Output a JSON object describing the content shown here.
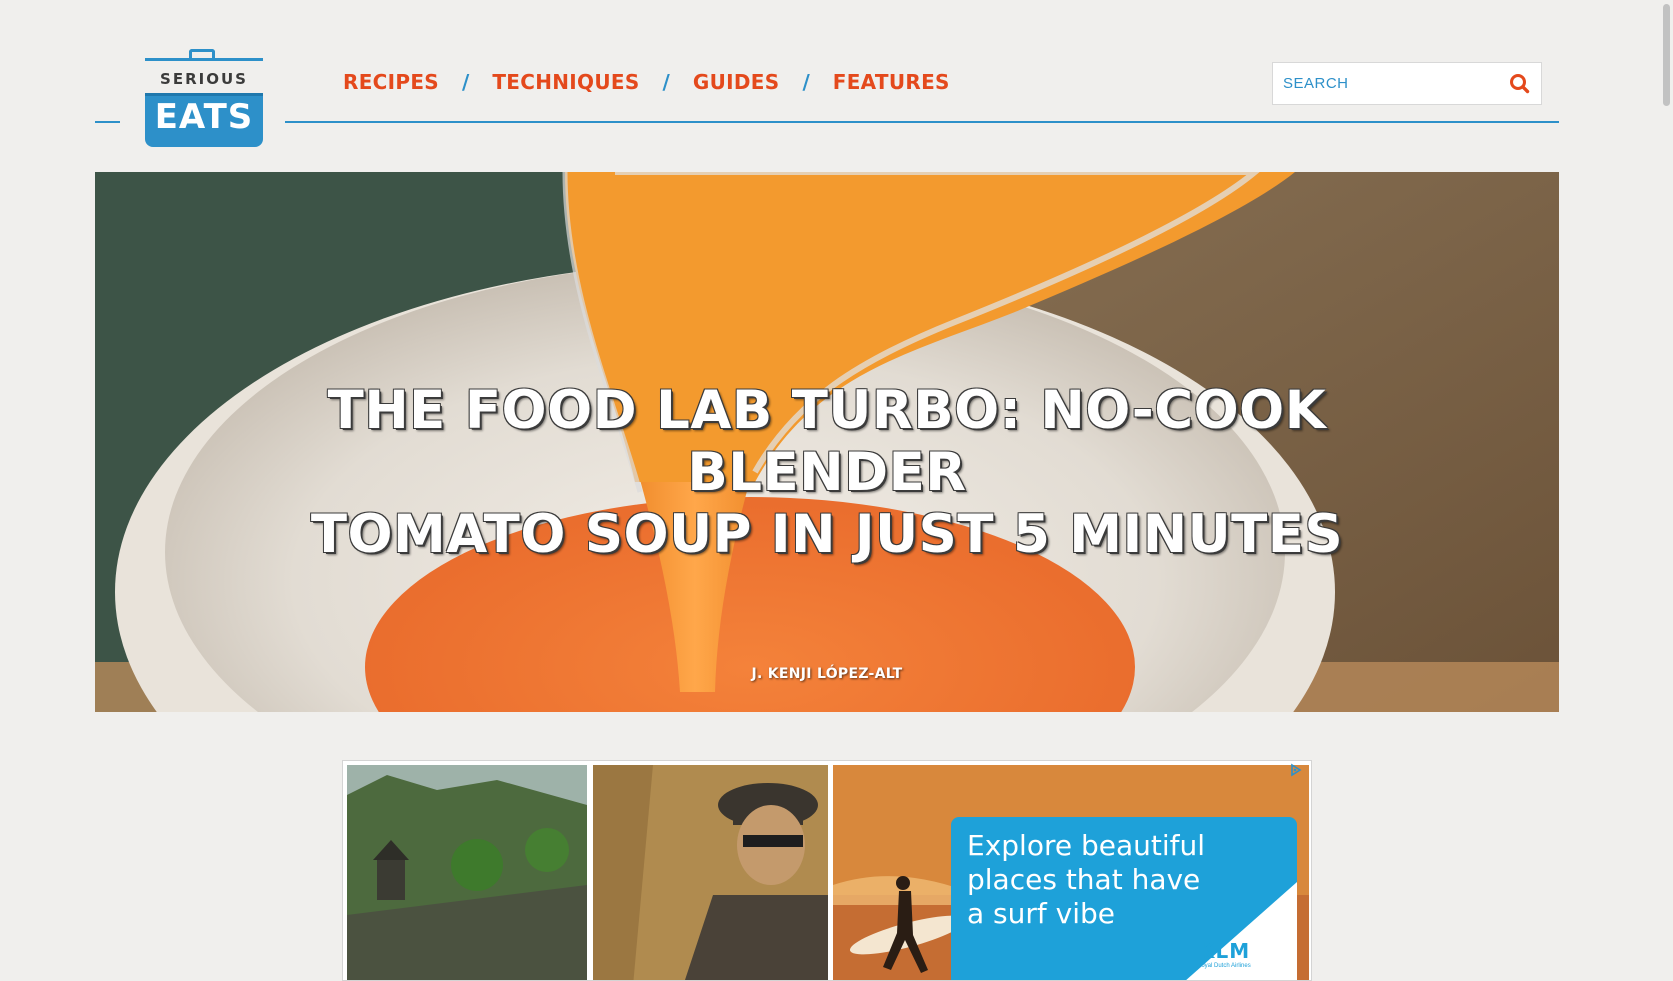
{
  "logo": {
    "top_text": "SERIOUS",
    "bottom_text": "EATS",
    "color": "#2d90c9"
  },
  "nav": {
    "items": [
      "RECIPES",
      "TECHNIQUES",
      "GUIDES",
      "FEATURES"
    ],
    "separator": "/",
    "link_color": "#e4491c",
    "separator_color": "#2d90c9"
  },
  "search": {
    "placeholder": "SEARCH",
    "icon": "search-icon"
  },
  "hero": {
    "title_line1": "THE FOOD LAB TURBO: NO-COOK BLENDER",
    "title_line2": "TOMATO SOUP IN JUST 5 MINUTES",
    "author": "J. KENJI LÓPEZ-ALT"
  },
  "ad": {
    "message_line1": "Explore beautiful",
    "message_line2": "places that have",
    "message_line3": "a surf vibe",
    "brand": "KLM",
    "brand_sub": "Royal Dutch Airlines",
    "brand_color": "#1ea1d9",
    "adchoices_icon": "adchoices-icon"
  }
}
